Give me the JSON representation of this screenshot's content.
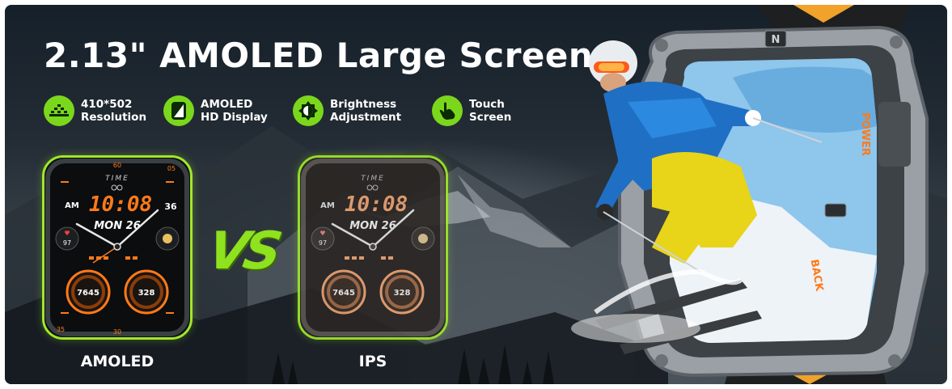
{
  "title": "2.13\" AMOLED Large Screen",
  "features": [
    {
      "icon": "resolution-icon",
      "line1": "410*502",
      "line2": "Resolution"
    },
    {
      "icon": "display-icon",
      "line1": "AMOLED",
      "line2": "HD Display"
    },
    {
      "icon": "brightness-icon",
      "line1": "Brightness",
      "line2": "Adjustment"
    },
    {
      "icon": "touch-icon",
      "line1": "Touch",
      "line2": "Screen"
    }
  ],
  "comparison": {
    "left_label": "AMOLED",
    "right_label": "IPS",
    "vs_text": "VS"
  },
  "watch_face": {
    "time_label": "TIME",
    "ampm": "AM",
    "time": "10:08",
    "date": "MON 26",
    "heart": "97",
    "steps": "7645",
    "calories": "328",
    "bezel_top": "60",
    "bezel_tr": "05",
    "bezel_side": "35",
    "seconds_side": "36",
    "bezel_bottom": "30"
  },
  "device_buttons": {
    "power": "POWER",
    "back": "BACK"
  },
  "colors": {
    "accent_green": "#7bd71c",
    "amoled_orange": "#ff7a1a",
    "ips_orange": "#e8a070"
  }
}
